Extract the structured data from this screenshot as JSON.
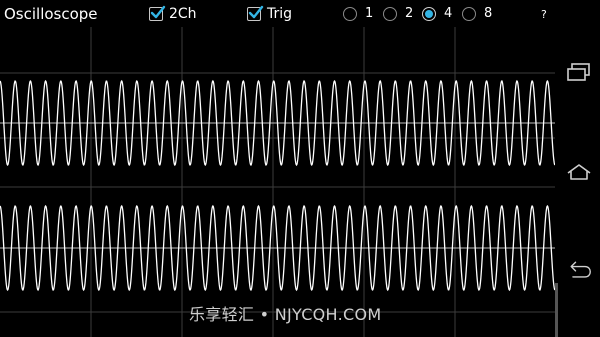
{
  "app": {
    "title": "Oscilloscope"
  },
  "controls": {
    "checkboxes": [
      {
        "label": "2Ch",
        "checked": true
      },
      {
        "label": "Trig",
        "checked": true
      }
    ],
    "radios": [
      {
        "label": "1",
        "selected": false
      },
      {
        "label": "2",
        "selected": false
      },
      {
        "label": "4",
        "selected": true
      },
      {
        "label": "8",
        "selected": false
      }
    ],
    "help_label": "?",
    "accent_color": "#33b5e5"
  },
  "scope": {
    "channels": 2,
    "trace_color": "#ffffff",
    "grid_color": "#3c3c3c",
    "cycles_visible": 36.5
  },
  "nav": {
    "icons": [
      "recent-apps-icon",
      "home-icon",
      "back-icon"
    ]
  },
  "watermark": "乐享轻汇 • NJYCQH.COM"
}
